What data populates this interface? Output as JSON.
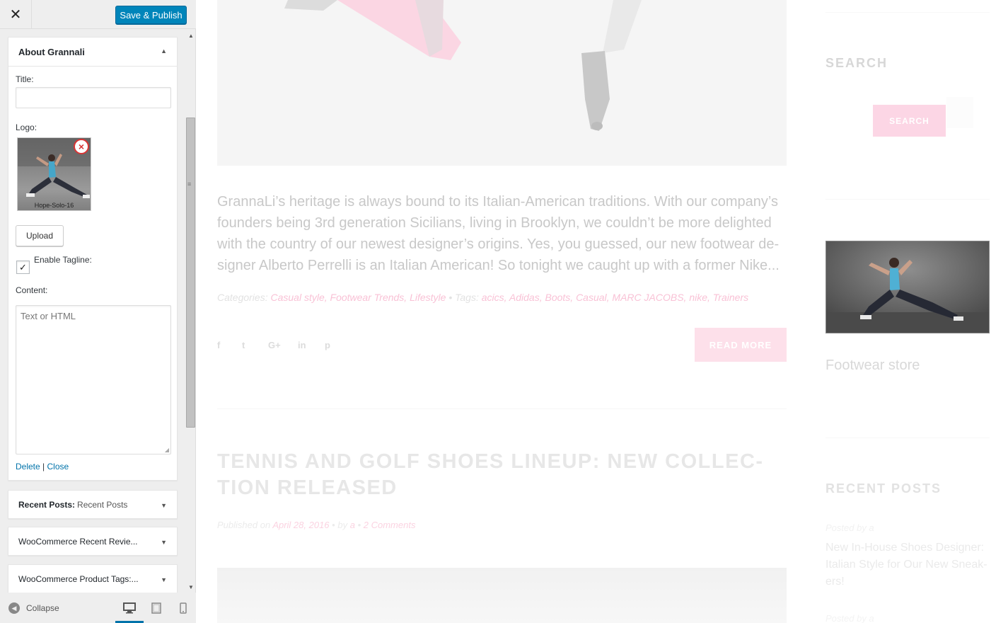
{
  "customizer": {
    "save_publish": "Save & Publish",
    "close_glyph": "✕",
    "widget_about": {
      "title": "About Grannali",
      "title_label": "Title:",
      "title_value": "",
      "logo_label": "Logo:",
      "logo_caption": "Hope-Solo-16",
      "upload_label": "Upload",
      "tagline_label": "Enable Tagline:",
      "tagline_checked": true,
      "content_label": "Content:",
      "content_placeholder": "Text or HTML",
      "delete_label": "Delete",
      "separator": "|",
      "close_label": "Close"
    },
    "collapsed_widgets": [
      {
        "name": "Recent Posts:",
        "subtitle": "Recent Posts"
      },
      {
        "name": "WooCommerce Recent Revie...",
        "subtitle": ""
      },
      {
        "name": "WooCommerce Product Tags:...",
        "subtitle": ""
      }
    ],
    "footer": {
      "collapse_label": "Collapse",
      "devices": [
        "desktop-icon",
        "tablet-icon",
        "mobile-icon"
      ],
      "active_device": "desktop"
    }
  },
  "preview": {
    "excerpt": "GrannaLi’s heritage is always bound to its Italian-American traditions. With our company’s founders being 3rd generation Sicilians, living in Brooklyn, we couldn’t be more delighted with the country of our newest designer’s origins. Yes, you guessed, our new footwear de-signer Alberto Perrelli is an Italian American! So tonight we caught up with a former Nike...",
    "categories_label": "Categories:",
    "categories": "Casual style, Footwear Trends, Lifestyle",
    "tags_label": "Tags:",
    "tags": "acics, Adidas, Boots, Casual, MARC JACOBS, nike, Trainers",
    "meta_separator": "•",
    "social": [
      "f",
      "t",
      "G+",
      "in",
      "p"
    ],
    "read_more": "READ MORE",
    "post2_title": "TENNIS AND GOLF SHOES LINEUP: NEW COLLEC-TION RELEASED",
    "post2_published": "Published on",
    "post2_date": "April 28, 2016",
    "post2_by": "by",
    "post2_author": "a",
    "post2_comments": "2 Comments",
    "sidebar": {
      "search_title": "SEARCH",
      "search_button": "SEARCH",
      "image_caption": "Footwear store",
      "recent_title": "RECENT POSTS",
      "posted_by": "Posted by a",
      "recent_link": "New In-House Shoes Designer: Italian Style for Our New Sneak-ers!",
      "posted_by_2": "Posted by a"
    }
  },
  "colors": {
    "primary_button": "#0085ba",
    "link": "#0073aa",
    "accent_pink": "#f9c2d6"
  }
}
